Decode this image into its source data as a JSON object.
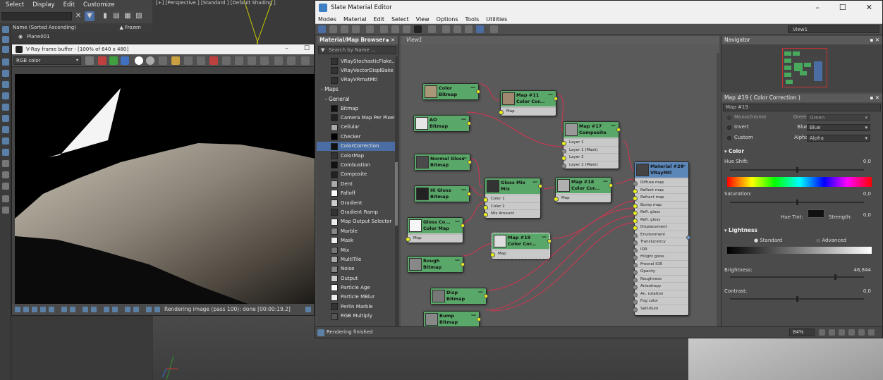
{
  "max": {
    "menu": [
      "Select",
      "Display",
      "Edit",
      "Customize"
    ],
    "scene_header": "Name (Sorted Ascending)",
    "frozen_label": "Frozen",
    "scene_item": "Plane001",
    "viewport_label": "[+] [Perspective ] [Standard ] [Default Shading ]"
  },
  "vfb": {
    "title": "V-Ray frame buffer - [100% of 640 x 480]",
    "channel": "RGB color",
    "status": "Rendering image (pass 100): done [00:00:19.2]"
  },
  "sme": {
    "title": "Slate Material Editor",
    "menu": [
      "Modes",
      "Material",
      "Edit",
      "Select",
      "View",
      "Options",
      "Tools",
      "Utilities"
    ],
    "view_select": "View1",
    "browser": {
      "title": "Material/Map Browser",
      "search_placeholder": "Search by Name ...",
      "items": [
        {
          "label": "VRayStochasticFlake...",
          "kind": "item"
        },
        {
          "label": "VRayVectorDisplBake",
          "kind": "item"
        },
        {
          "label": "VRayVRmatMtl",
          "kind": "item"
        },
        {
          "label": "- Maps",
          "kind": "cat"
        },
        {
          "label": "- General",
          "kind": "sub"
        },
        {
          "label": "Bitmap",
          "kind": "item"
        },
        {
          "label": "Camera Map Per Pixel",
          "kind": "item"
        },
        {
          "label": "Cellular",
          "kind": "item"
        },
        {
          "label": "Checker",
          "kind": "item"
        },
        {
          "label": "ColorCorrection",
          "kind": "item",
          "selected": true
        },
        {
          "label": "ColorMap",
          "kind": "item"
        },
        {
          "label": "Combustion",
          "kind": "item"
        },
        {
          "label": "Composite",
          "kind": "item"
        },
        {
          "label": "Dent",
          "kind": "item"
        },
        {
          "label": "Falloff",
          "kind": "item"
        },
        {
          "label": "Gradient",
          "kind": "item"
        },
        {
          "label": "Gradient Ramp",
          "kind": "item"
        },
        {
          "label": "Map Output Selector",
          "kind": "item"
        },
        {
          "label": "Marble",
          "kind": "item"
        },
        {
          "label": "Mask",
          "kind": "item"
        },
        {
          "label": "Mix",
          "kind": "item"
        },
        {
          "label": "MultiTile",
          "kind": "item"
        },
        {
          "label": "Noise",
          "kind": "item"
        },
        {
          "label": "Output",
          "kind": "item"
        },
        {
          "label": "Particle Age",
          "kind": "item"
        },
        {
          "label": "Particle MBlur",
          "kind": "item"
        },
        {
          "label": "Perlin Marble",
          "kind": "item"
        },
        {
          "label": "RGB Multiply",
          "kind": "item"
        }
      ]
    },
    "view_tab": "View1",
    "nodes": {
      "color_bitmap": [
        "Color",
        "Bitmap"
      ],
      "ao_bitmap": [
        "AO",
        "Bitmap"
      ],
      "normal_gloss_bitmap": [
        "Normal Gloss",
        "Bitmap"
      ],
      "hi_gloss_bitmap": [
        "Hi Gloss",
        "Bitmap"
      ],
      "gloss_color_map": [
        "Gloss Co...",
        "Color Map"
      ],
      "rough_bitmap": [
        "Rough",
        "Bitmap"
      ],
      "disp_bitmap": [
        "Disp",
        "Bitmap"
      ],
      "bump_bitmap": [
        "Bump",
        "Bitmap"
      ],
      "map11": [
        "Map #11",
        "Color Cor..."
      ],
      "map17": [
        "Map #17",
        "Composite"
      ],
      "gloss_mix": [
        "Gloss Mix",
        "Mix"
      ],
      "map18": [
        "Map #18",
        "Color Cor..."
      ],
      "map19": [
        "Map #19",
        "Color Cor..."
      ],
      "material26": [
        "Material #26",
        "VRayMtl"
      ]
    },
    "slots": {
      "map": "Map",
      "composite": [
        "Layer 1",
        "Layer 1 (Mask)",
        "Layer 2",
        "Layer 2 (Mask)"
      ],
      "mix": [
        "Color 1",
        "Color 2",
        "Mix Amount"
      ],
      "vraymtl": [
        "Diffuse map",
        "Reflect map",
        "Refract map",
        "Bump map",
        "Refl. gloss",
        "Refr. gloss",
        "Displacement",
        "Environment",
        "Translucency",
        "IOR",
        "Hilight gloss",
        "Fresnel IOR",
        "Opacity",
        "Roughness",
        "Anisotropy",
        "An. rotation",
        "Fog color",
        "Self-illum"
      ]
    },
    "navigator_title": "Navigator",
    "props": {
      "title": "Map #19 ( Color Correction )",
      "map_name": "Map #19",
      "rows": [
        {
          "radio": "Monochrome",
          "channel": "Green =",
          "value": "Green"
        },
        {
          "radio": "Invert",
          "channel": "Blue =",
          "value": "Blue"
        },
        {
          "radio": "Custom",
          "channel": "Alpha =",
          "value": "Alpha"
        }
      ],
      "color_section": "Color",
      "hue_shift_label": "Hue Shift:",
      "hue_shift_value": "0,0",
      "saturation_label": "Saturation:",
      "saturation_value": "0,0",
      "hue_tint_label": "Hue Tint:",
      "strength_label": "Strength:",
      "strength_value": "0,0",
      "lightness_section": "Lightness",
      "standard_label": "Standard",
      "advanced_label": "Advanced",
      "brightness_label": "Brightness:",
      "brightness_value": "46,844",
      "contrast_label": "Contrast:",
      "contrast_value": "0,0"
    },
    "status": "Rendering finished",
    "zoom": "84%"
  }
}
